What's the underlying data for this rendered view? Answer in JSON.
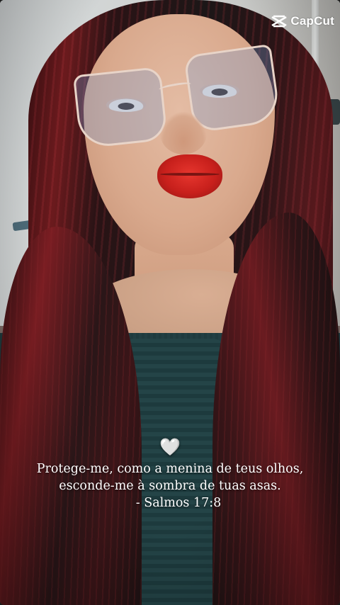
{
  "watermark": {
    "brand": "CapCut",
    "icon": "capcut-logo-icon"
  },
  "caption": {
    "emoji": "🤍",
    "line1": "Protege-me, como a menina de teus olhos,",
    "line2": "esconde-me à sombra de tuas asas.",
    "reference": "- Salmos 17:8"
  },
  "colors": {
    "text": "#ffffff",
    "lips": "#c8201c",
    "hair": "#6b1a1d",
    "sweater": "#1f3b3e"
  }
}
